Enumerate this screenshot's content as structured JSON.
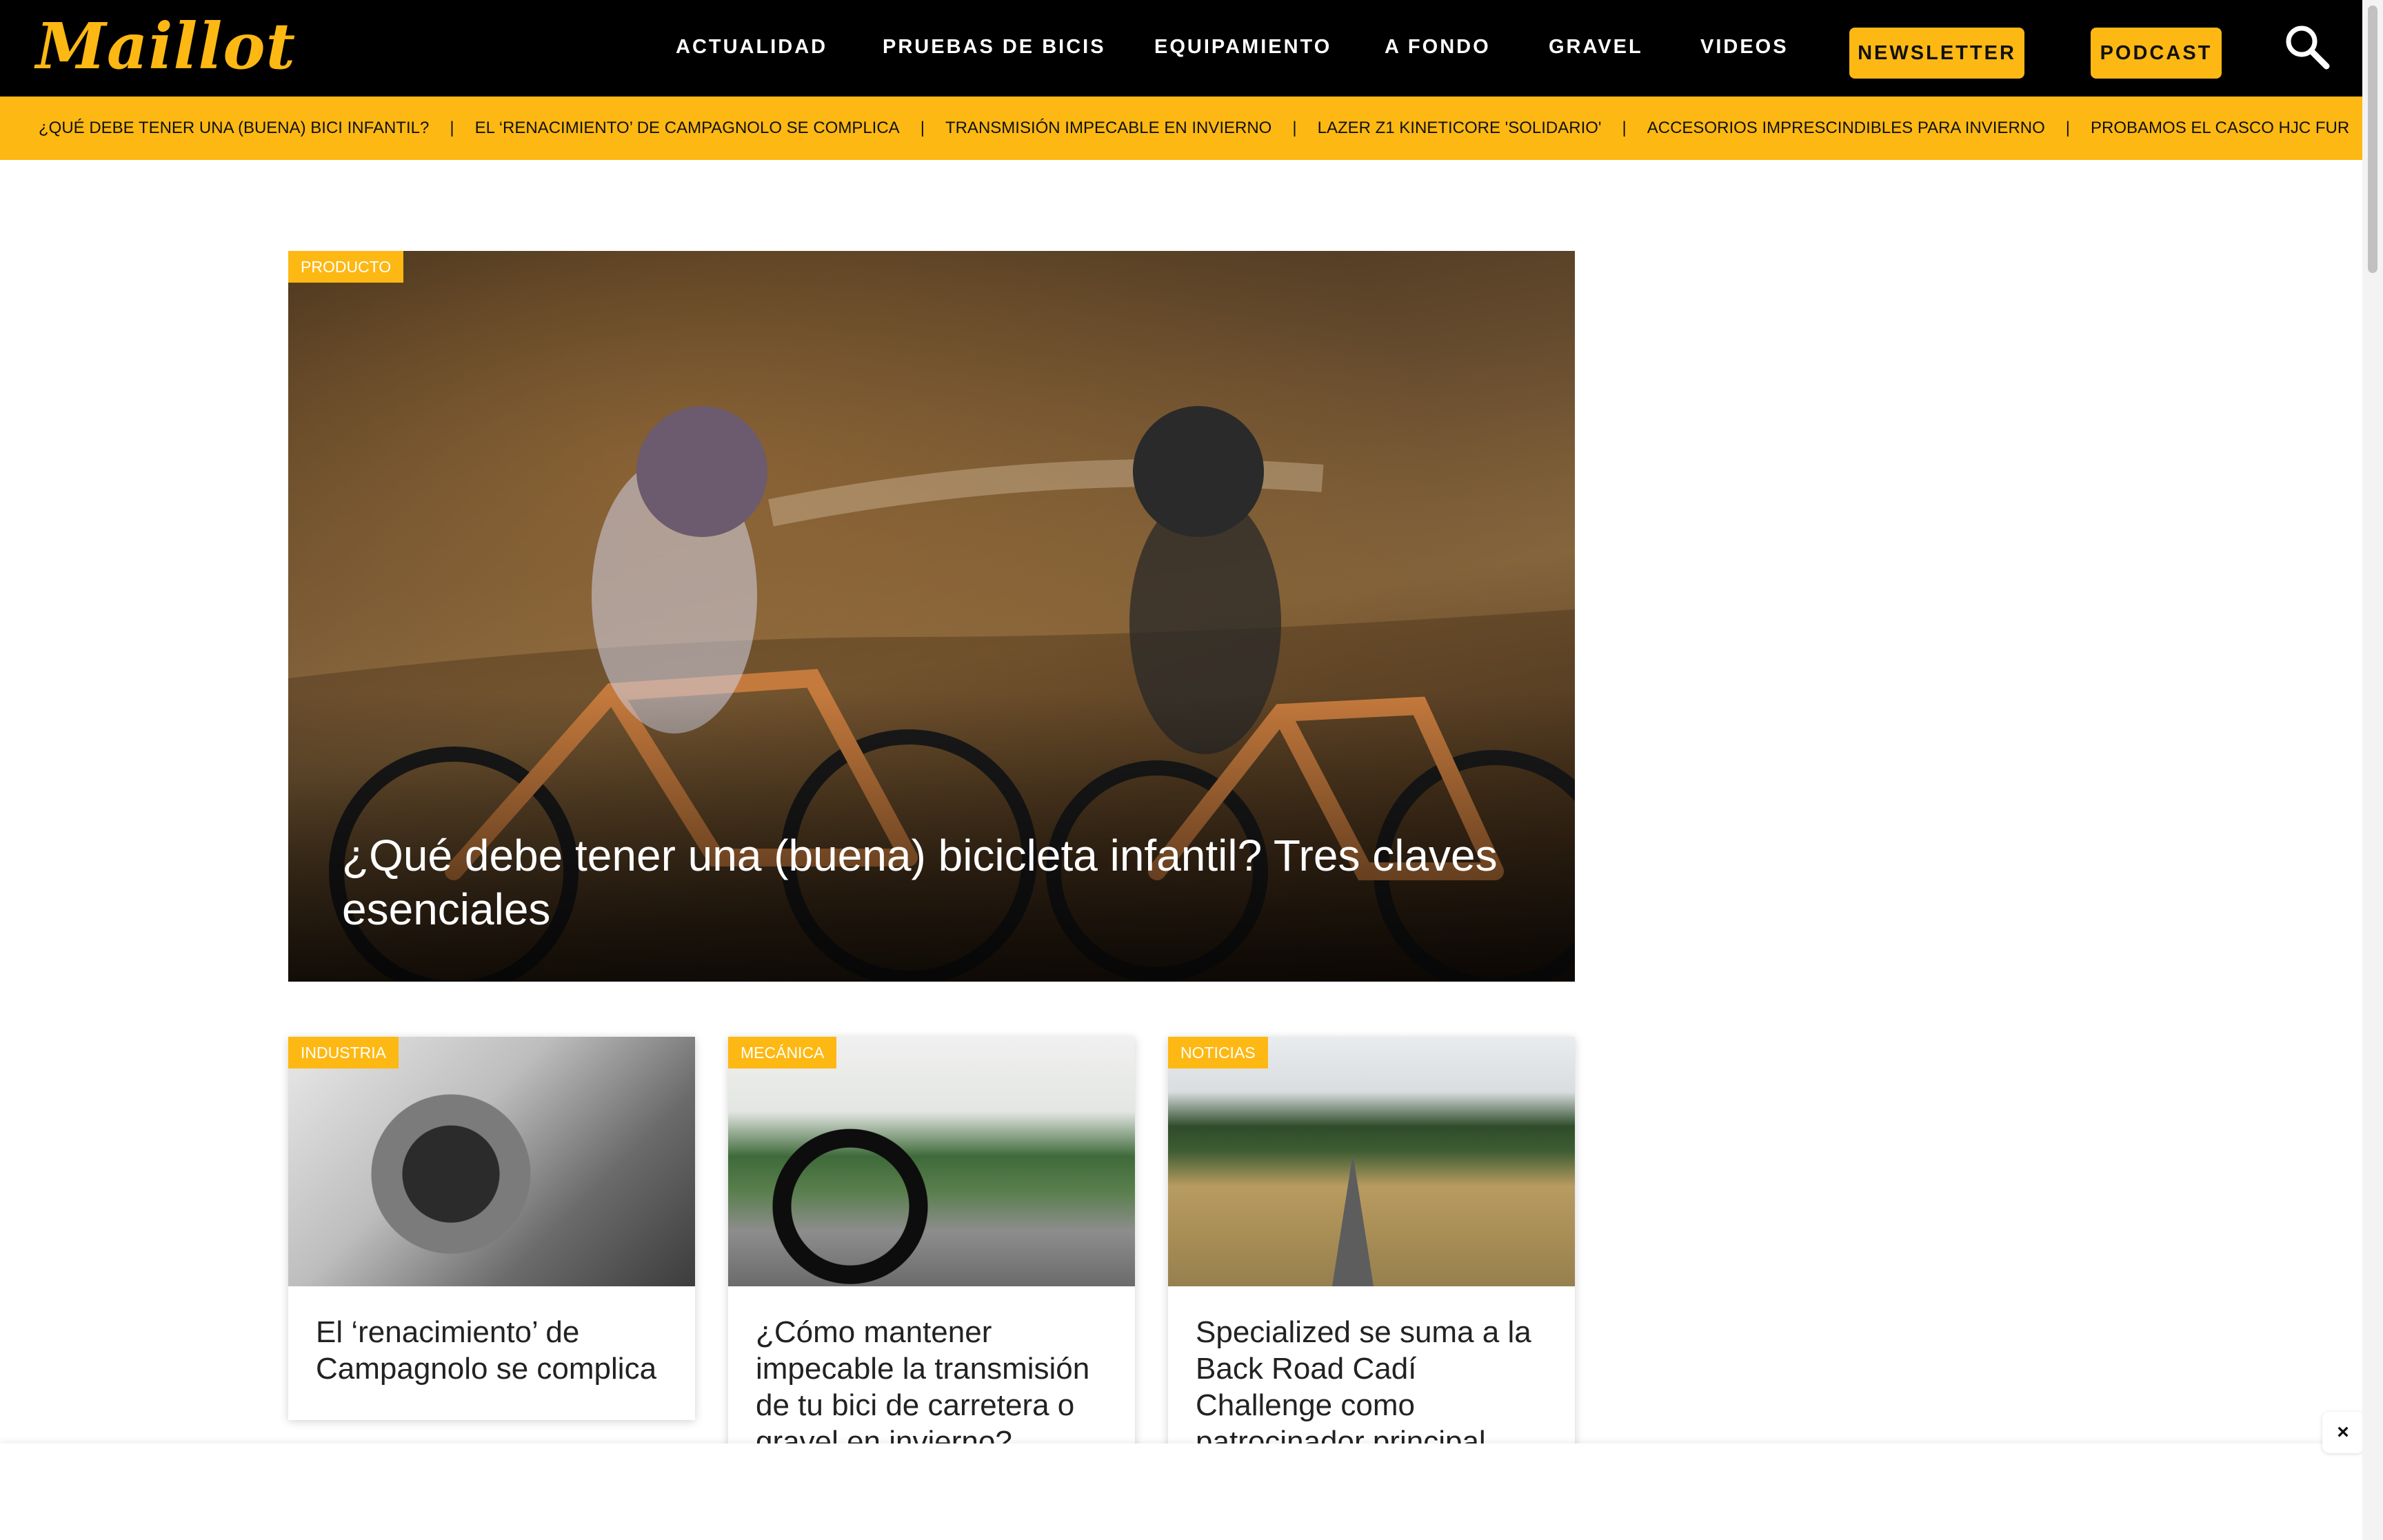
{
  "brand": {
    "logo_text": "Maillot",
    "accent_color": "#FDB813"
  },
  "nav": {
    "links": [
      "ACTUALIDAD",
      "PRUEBAS DE BICIS",
      "EQUIPAMIENTO",
      "A FONDO",
      "GRAVEL",
      "VIDEOS"
    ],
    "newsletter_label": "NEWSLETTER",
    "podcast_label": "PODCAST",
    "search_icon": "search-icon"
  },
  "ticker": {
    "items": [
      "¿QUÉ DEBE TENER UNA (BUENA) BICI INFANTIL?",
      "EL ‘RENACIMIENTO’ DE CAMPAGNOLO SE COMPLICA",
      "TRANSMISIÓN IMPECABLE EN INVIERNO",
      "LAZER Z1 KINETICORE 'SOLIDARIO'",
      "ACCESORIOS IMPRESCINDIBLES PARA INVIERNO",
      "PROBAMOS EL CASCO HJC FUR"
    ],
    "separator": "|"
  },
  "hero": {
    "category": "PRODUCTO",
    "title": "¿Qué debe tener una (buena) bicicleta infantil? Tres claves esenciales"
  },
  "cards": [
    {
      "category": "INDUSTRIA",
      "title": "El ‘renacimiento’ de Campagnolo se complica"
    },
    {
      "category": "MECÁNICA",
      "title": "¿Cómo mantener impecable la transmisión de tu bici de carretera o gravel en invierno?"
    },
    {
      "category": "NOTICIAS",
      "title": "Specialized se suma a la Back Road Cadí Challenge como patrocinador principal"
    }
  ],
  "ad": {
    "close_label": "×"
  }
}
